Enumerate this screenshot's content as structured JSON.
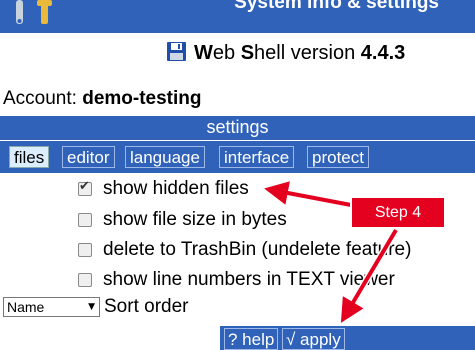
{
  "header": {
    "title": "System info & settings"
  },
  "version": {
    "w": "W",
    "eb": "eb ",
    "s": "S",
    "hell": "hell version ",
    "number": "4.4.3"
  },
  "account": {
    "label": "Account: ",
    "value": "demo-testing"
  },
  "settings": {
    "title": "settings"
  },
  "tabs": [
    {
      "label": "files",
      "active": true
    },
    {
      "label": "editor"
    },
    {
      "label": "language"
    },
    {
      "label": "interface"
    },
    {
      "label": "protect"
    }
  ],
  "options": [
    {
      "label": "show hidden files",
      "checked": true
    },
    {
      "label": "show file size in bytes",
      "checked": false
    },
    {
      "label": "delete to TrashBin (undelete feature)",
      "checked": false
    },
    {
      "label": "show line numbers in TEXT viewer",
      "checked": false
    }
  ],
  "sort": {
    "selected": "Name",
    "label": "Sort order"
  },
  "buttons": {
    "help": "? help",
    "apply": "√ apply"
  },
  "annotation": {
    "label": "Step 4",
    "color": "#e4001f"
  },
  "colors": {
    "header": "#2f62b8",
    "active_tab": "#dcedfb"
  }
}
